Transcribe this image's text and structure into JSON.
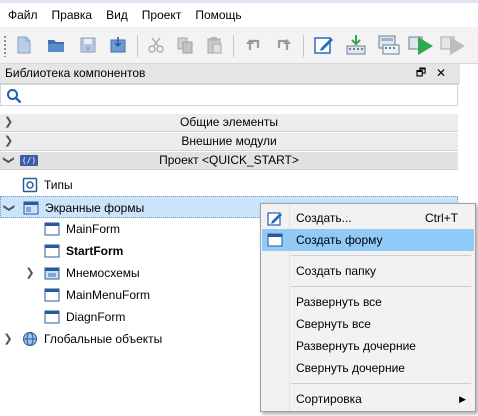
{
  "menubar": {
    "items": [
      "Файл",
      "Правка",
      "Вид",
      "Проект",
      "Помощь"
    ]
  },
  "toolbar": {
    "icons": [
      "new-icon",
      "open-icon",
      "save-icon",
      "save-as-icon",
      "cut-icon",
      "copy-icon",
      "paste-icon",
      "undo-icon",
      "redo-icon",
      "edit-icon",
      "download-icon",
      "build-icon",
      "run-icon",
      "debug-icon"
    ]
  },
  "panel": {
    "title": "Библиотека компонентов",
    "float_glyph": "🗗",
    "close_glyph": "✕"
  },
  "search": {
    "placeholder": "",
    "value": ""
  },
  "groups": {
    "common": "Общие элементы",
    "external": "Внешние модули",
    "project": "Проект <QUICK_START>",
    "project_icon_text": "(/)"
  },
  "tree": {
    "types": "Типы",
    "screen_forms": "Экранные формы",
    "main_form": "MainForm",
    "start_form": "StartForm",
    "mnemo": "Мнемосхемы",
    "main_menu_form": "MainMenuForm",
    "diagn_form": "DiagnForm",
    "global_objects": "Глобальные объекты"
  },
  "context_menu": {
    "create": "Создать...",
    "create_shortcut": "Ctrl+T",
    "create_form": "Создать форму",
    "create_folder": "Создать папку",
    "expand_all": "Развернуть все",
    "collapse_all": "Свернуть все",
    "expand_children": "Развернуть дочерние",
    "collapse_children": "Свернуть дочерние",
    "sort": "Сортировка"
  },
  "colors": {
    "selection": "#cce4fa",
    "menu_highlight": "#91c9f7",
    "accent_blue": "#3a5ea8",
    "run_green": "#2fa84f"
  }
}
